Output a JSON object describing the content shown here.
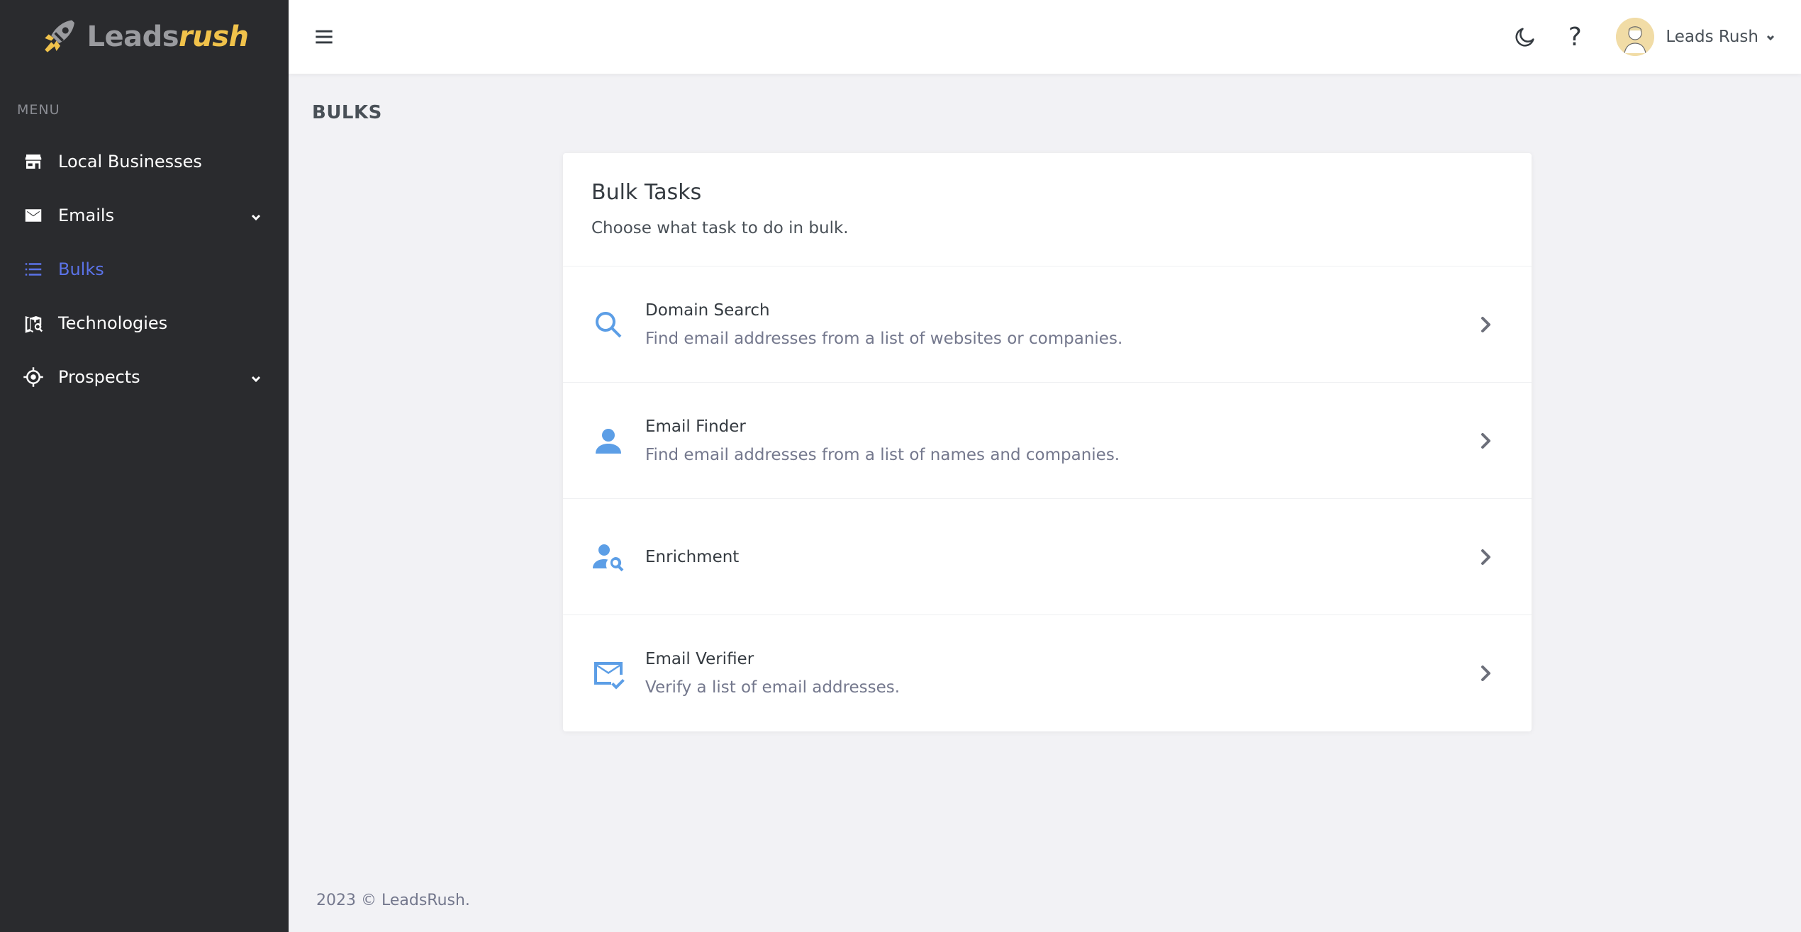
{
  "brand": {
    "lead": "Leads",
    "rush": "rush"
  },
  "sidebar": {
    "menu_title": "MENU",
    "items": [
      {
        "label": "Local Businesses",
        "icon": "store-icon",
        "has_submenu": false,
        "active": false
      },
      {
        "label": "Emails",
        "icon": "mail-icon",
        "has_submenu": true,
        "active": false
      },
      {
        "label": "Bulks",
        "icon": "list-icon",
        "has_submenu": false,
        "active": true
      },
      {
        "label": "Technologies",
        "icon": "map-search-icon",
        "has_submenu": false,
        "active": false
      },
      {
        "label": "Prospects",
        "icon": "target-icon",
        "has_submenu": true,
        "active": false
      }
    ]
  },
  "topbar": {
    "help_label": "?",
    "user_name": "Leads Rush"
  },
  "page": {
    "title": "BULKS"
  },
  "card": {
    "title": "Bulk Tasks",
    "subtitle": "Choose what task to do in bulk.",
    "tasks": [
      {
        "name": "Domain Search",
        "desc": "Find email addresses from a list of websites or companies.",
        "icon": "search-icon"
      },
      {
        "name": "Email Finder",
        "desc": "Find email addresses from a list of names and companies.",
        "icon": "person-icon"
      },
      {
        "name": "Enrichment",
        "desc": "",
        "icon": "person-search-icon"
      },
      {
        "name": "Email Verifier",
        "desc": "Verify a list of email addresses.",
        "icon": "mail-check-icon"
      }
    ]
  },
  "footer": {
    "text": "2023 © LeadsRush."
  },
  "colors": {
    "sidebar_bg": "#2a2b2e",
    "accent": "#5b73e8",
    "brand_yellow": "#f0c24b",
    "task_icon": "#5c9ee6"
  }
}
